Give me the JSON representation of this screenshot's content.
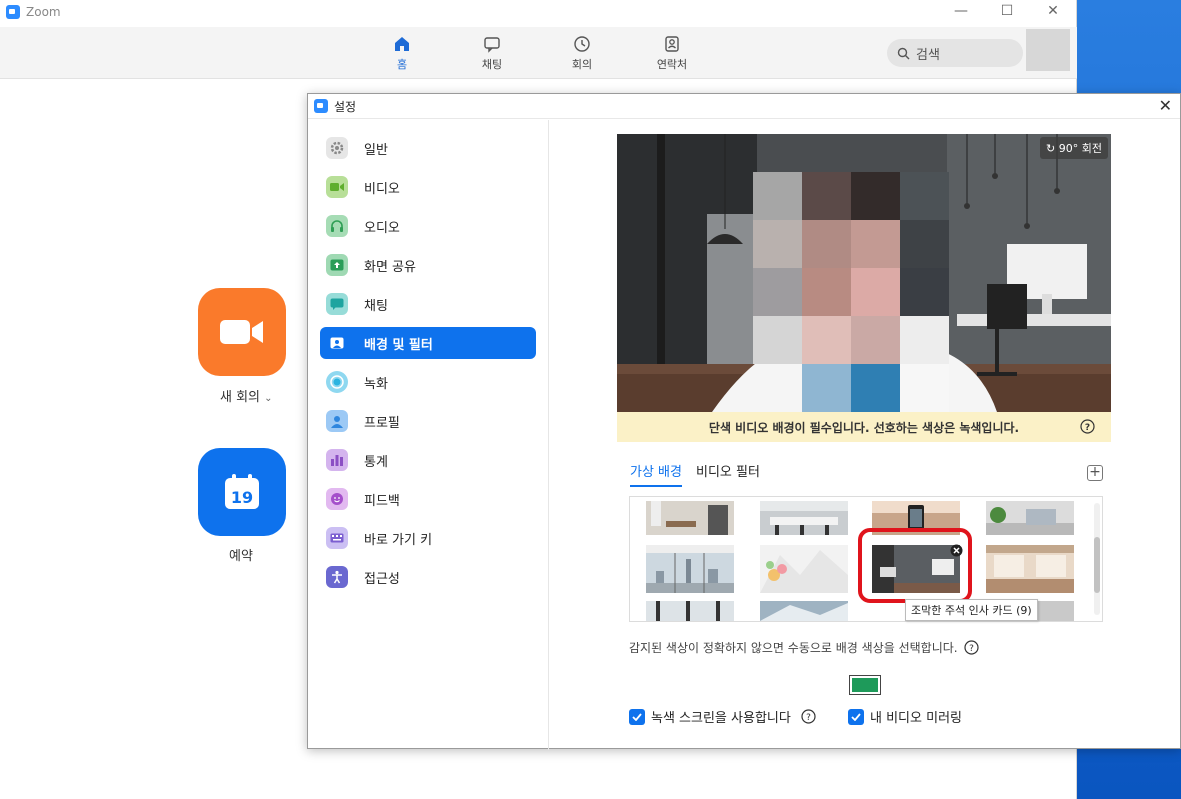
{
  "main_window": {
    "title": "Zoom",
    "controls": {
      "minimize": "—",
      "maximize": "☐",
      "close": "✕"
    },
    "tabs": [
      {
        "label": "홈",
        "icon": "home-icon",
        "active": true
      },
      {
        "label": "채팅",
        "icon": "chat-icon",
        "active": false
      },
      {
        "label": "회의",
        "icon": "clock-icon",
        "active": false
      },
      {
        "label": "연락처",
        "icon": "contacts-icon",
        "active": false
      }
    ],
    "search_placeholder": "검색",
    "home_actions": {
      "new_meeting": "새 회의",
      "new_meeting_arrow": "⌄",
      "schedule": "예약",
      "calendar_day": "19"
    }
  },
  "settings_dialog": {
    "title": "설정",
    "close": "✕",
    "sidebar": [
      {
        "label": "일반",
        "icon": "gear-icon",
        "color": "#9e9e9e"
      },
      {
        "label": "비디오",
        "icon": "video-icon",
        "color": "#7bc44a"
      },
      {
        "label": "오디오",
        "icon": "headphones-icon",
        "color": "#4cb86f"
      },
      {
        "label": "화면 공유",
        "icon": "share-screen-icon",
        "color": "#3cb371"
      },
      {
        "label": "채팅",
        "icon": "chat-icon",
        "color": "#2db5b0"
      },
      {
        "label": "배경 및 필터",
        "icon": "background-icon",
        "color": "#0e72ed",
        "active": true
      },
      {
        "label": "녹화",
        "icon": "record-icon",
        "color": "#2cb4e0"
      },
      {
        "label": "프로필",
        "icon": "profile-icon",
        "color": "#3f9be8"
      },
      {
        "label": "통계",
        "icon": "stats-icon",
        "color": "#a267d0"
      },
      {
        "label": "피드백",
        "icon": "feedback-icon",
        "color": "#b86ad6"
      },
      {
        "label": "바로 가기 키",
        "icon": "keyboard-icon",
        "color": "#8a6fd8"
      },
      {
        "label": "접근성",
        "icon": "accessibility-icon",
        "color": "#6a68d0"
      }
    ],
    "preview": {
      "rotate_label": "90° 회전",
      "notice": "단색 비디오 배경이 필수입니다. 선호하는 색상은 녹색입니다."
    },
    "bg_tabs": [
      {
        "label": "가상 배경",
        "active": true
      },
      {
        "label": "비디오 필터",
        "active": false
      }
    ],
    "add_button": "+",
    "tooltip": "조막한 주석 인사 카드 (9)",
    "hint": "감지된 색상이 정확하지 않으면 수동으로 배경 색상을 선택합니다.",
    "swatch_color": "#1e9a5a",
    "checkboxes": [
      {
        "label": "녹색 스크린을 사용합니다",
        "checked": true
      },
      {
        "label": "내 비디오 미러링",
        "checked": true
      }
    ]
  },
  "colors": {
    "accent": "#0e72ed",
    "orange": "#fa7a2b",
    "highlight_ring": "#e0141c"
  }
}
